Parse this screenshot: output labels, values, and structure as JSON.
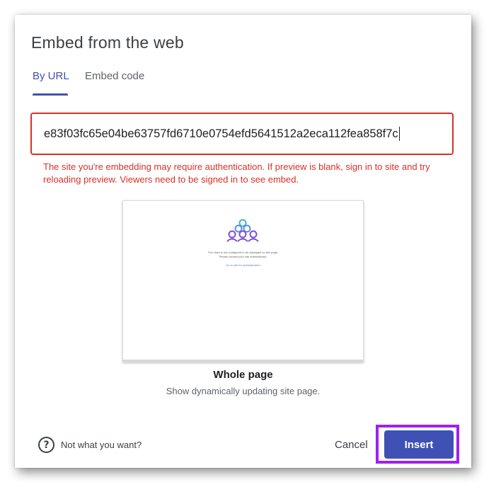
{
  "dialog": {
    "title": "Embed from the web"
  },
  "tabs": [
    {
      "label": "By URL",
      "active": true
    },
    {
      "label": "Embed code",
      "active": false
    }
  ],
  "url_input": {
    "value": "e83f03fc65e04be63757fd6710e0754efd5641512a2eca112fea858f7c"
  },
  "error_message": "The site you're embedding may require authentication. If preview is blank, sign in to site and try reloading preview. Viewers need to be signed in to see embed.",
  "preview": {
    "message_line1": "The chart is not configured to be displayed on this page.",
    "message_line2": "Please contact your site administrator.",
    "link_text": "Go to site for authentication",
    "title": "Whole page",
    "subtitle": "Show dynamically updating site page."
  },
  "footer": {
    "help_text": "Not what you want?",
    "cancel_label": "Cancel",
    "insert_label": "Insert"
  },
  "colors": {
    "accent": "#3f51b5",
    "error": "#d93025",
    "highlight": "#a020f0"
  },
  "icons": {
    "help": "question-circle-icon",
    "preview_logo": "people-network-icon"
  }
}
